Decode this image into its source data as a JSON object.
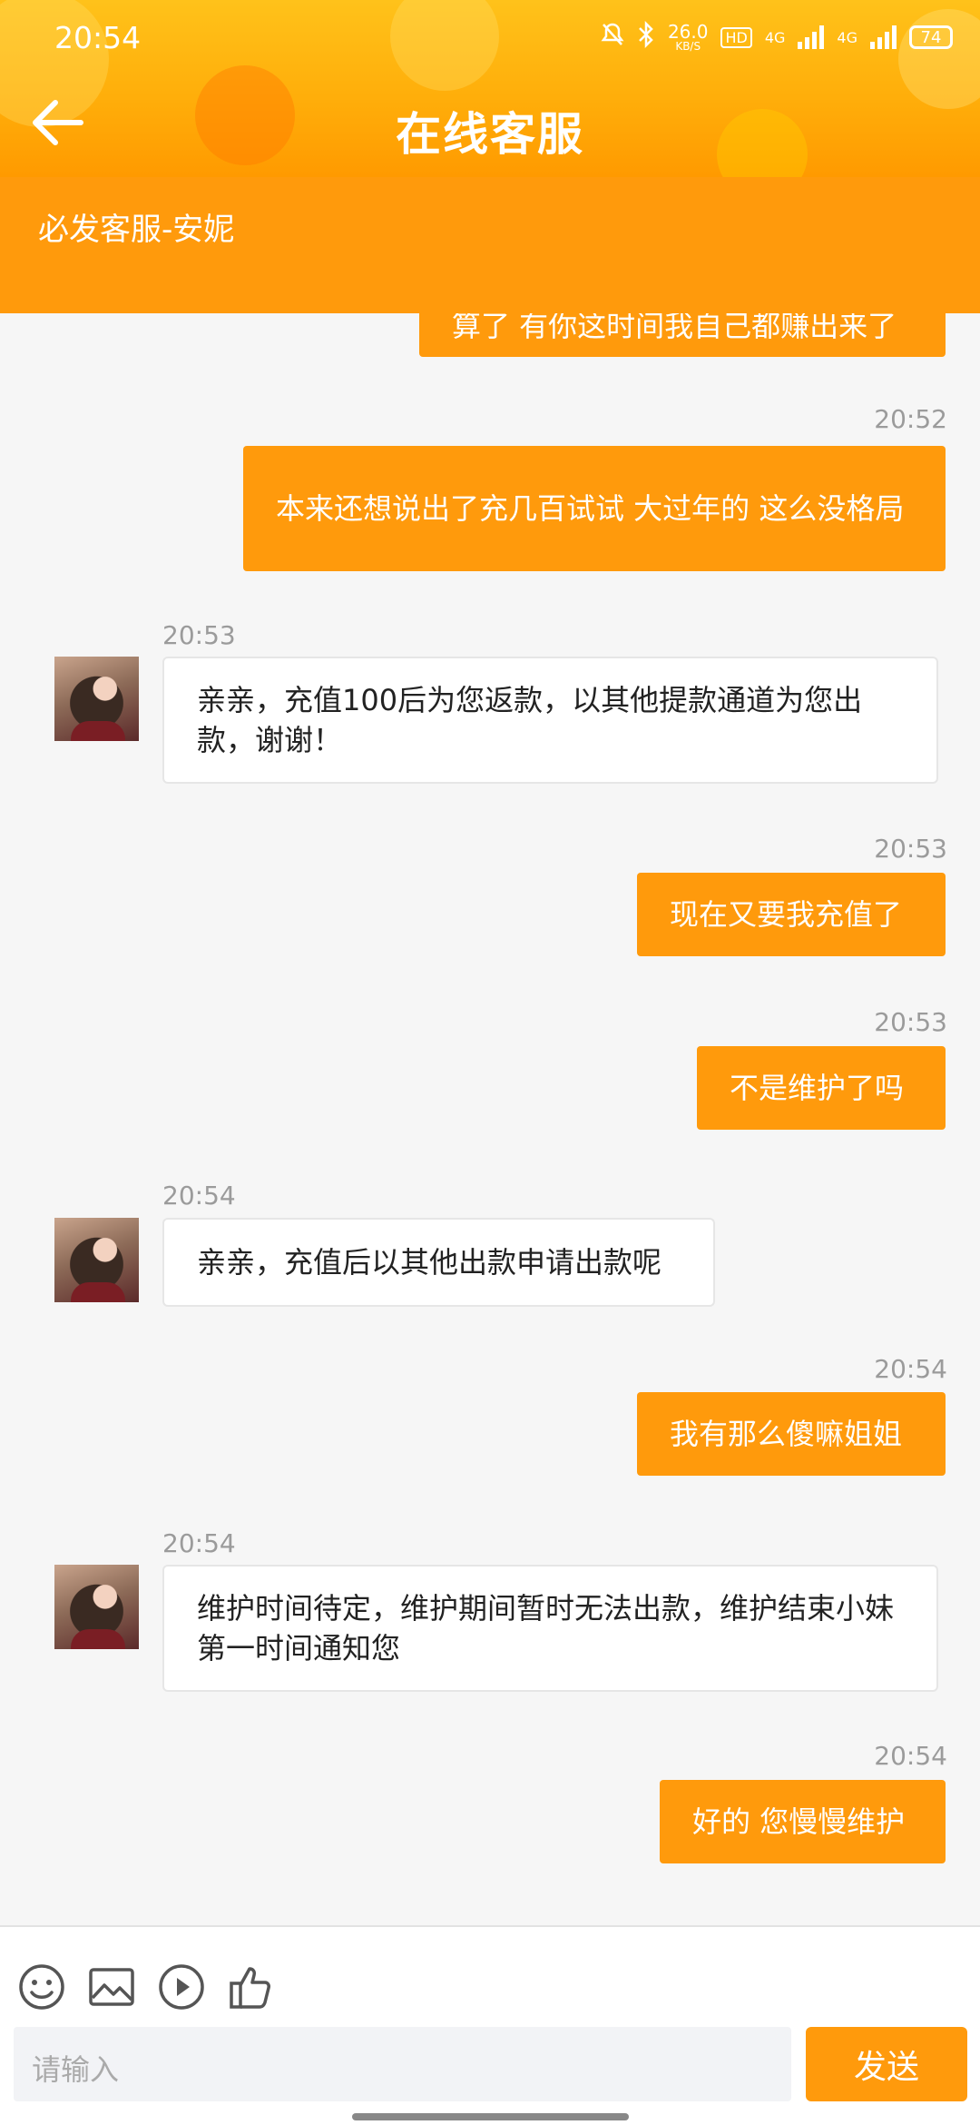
{
  "status_bar": {
    "time": "20:54",
    "network_speed": "26.0",
    "network_speed_unit": "KB/S",
    "hd_badge": "HD",
    "sim1": "4G",
    "sim2": "4G",
    "battery": "74"
  },
  "header": {
    "title": "在线客服",
    "back_icon": "arrow-left-icon"
  },
  "agent": {
    "name": "必发客服-安妮"
  },
  "messages": [
    {
      "side": "out",
      "time": "",
      "text": "算了 有你这时间我自己都赚出来了",
      "partial": true
    },
    {
      "side": "out",
      "time": "20:52",
      "text": "本来还想说出了充几百试试 大过年的 这么没格局"
    },
    {
      "side": "in",
      "time": "20:53",
      "text": "亲亲，充值100后为您返款，以其他提款通道为您出款，谢谢！"
    },
    {
      "side": "out",
      "time": "20:53",
      "text": "现在又要我充值了"
    },
    {
      "side": "out",
      "time": "20:53",
      "text": "不是维护了吗"
    },
    {
      "side": "in",
      "time": "20:54",
      "text": "亲亲，充值后以其他出款申请出款呢"
    },
    {
      "side": "out",
      "time": "20:54",
      "text": "我有那么傻嘛姐姐"
    },
    {
      "side": "in",
      "time": "20:54",
      "text": "维护时间待定，维护期间暂时无法出款，维护结束小妹第一时间通知您"
    },
    {
      "side": "out",
      "time": "20:54",
      "text": "好的 您慢慢维护"
    }
  ],
  "toolbar": {
    "icons": [
      "emoji-icon",
      "image-icon",
      "play-icon",
      "thumbs-up-icon"
    ],
    "input_placeholder": "请输入",
    "send_label": "发送"
  },
  "colors": {
    "accent": "#ff9a0c",
    "header_top": "#ffc21a",
    "bubble_in": "#ffffff",
    "background": "#f6f6f6"
  }
}
